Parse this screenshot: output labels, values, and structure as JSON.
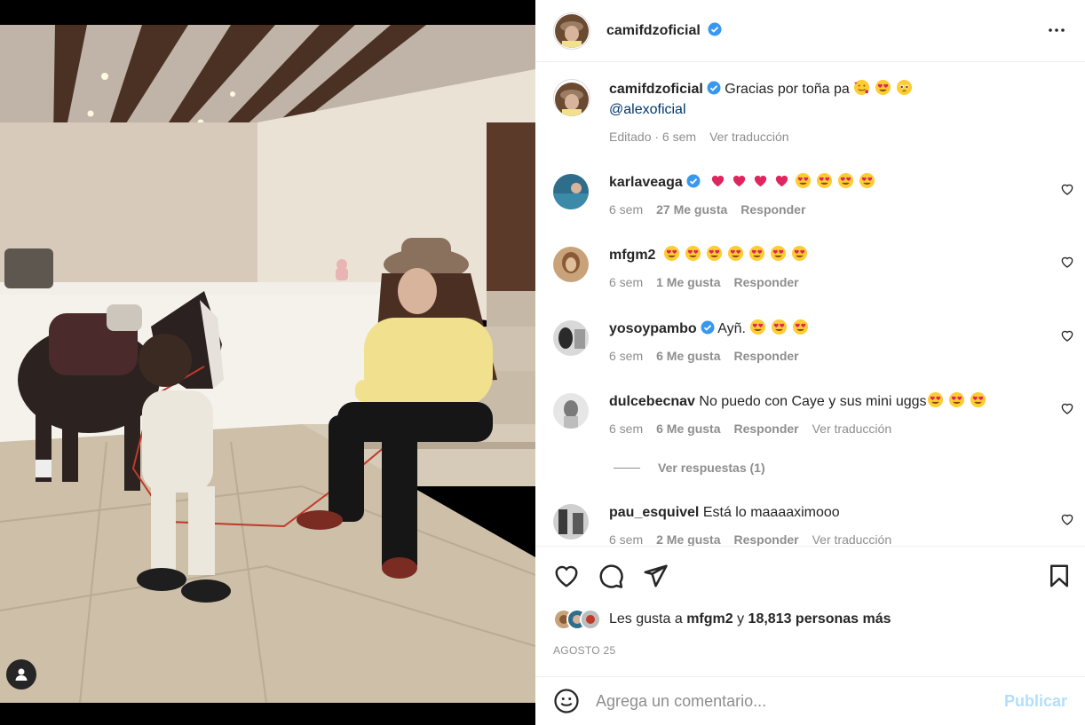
{
  "post": {
    "author": "camifdzoficial",
    "caption_text": "Gracias por toña pa",
    "caption_mention": "@alexoficial",
    "caption_meta_edited": "Editado · 6 sem",
    "caption_meta_translate": "Ver traducción"
  },
  "comments": [
    {
      "user": "karlaveaga",
      "verified": true,
      "text": "",
      "emojis": [
        "heart",
        "heart",
        "heart",
        "heart",
        "heart-eyes",
        "heart-eyes",
        "heart-eyes",
        "heart-eyes"
      ],
      "time": "6 sem",
      "likes": "27 Me gusta",
      "reply": "Responder",
      "translate": ""
    },
    {
      "user": "mfgm2",
      "verified": false,
      "text": "",
      "emojis": [
        "heart-eyes",
        "heart-eyes",
        "heart-eyes",
        "heart-eyes",
        "heart-eyes",
        "heart-eyes",
        "heart-eyes"
      ],
      "time": "6 sem",
      "likes": "1 Me gusta",
      "reply": "Responder",
      "translate": ""
    },
    {
      "user": "yosoypambo",
      "verified": true,
      "text": "Ayñ.",
      "emojis": [
        "heart-eyes",
        "heart-eyes",
        "heart-eyes"
      ],
      "time": "6 sem",
      "likes": "6 Me gusta",
      "reply": "Responder",
      "translate": ""
    },
    {
      "user": "dulcebecnav",
      "verified": false,
      "text": "No puedo con Caye y sus mini uggs",
      "emojis": [
        "heart-eyes",
        "heart-eyes",
        "heart-eyes"
      ],
      "time": "6 sem",
      "likes": "6 Me gusta",
      "reply": "Responder",
      "translate": "Ver traducción"
    },
    {
      "user": "pau_esquivel",
      "verified": false,
      "text": "Está lo maaaaximooo",
      "emojis": [],
      "time": "6 sem",
      "likes": "2 Me gusta",
      "reply": "Responder",
      "translate": "Ver traducción"
    }
  ],
  "view_replies": "Ver respuestas (1)",
  "likes": {
    "prefix": "Les gusta a",
    "user": "mfgm2",
    "connector": "y",
    "count": "18,813 personas más"
  },
  "date": "AGOSTO 25",
  "add_comment": {
    "placeholder": "Agrega un comentario...",
    "publish": "Publicar"
  },
  "colors": {
    "verified": "#3897f0",
    "link": "#00376b",
    "muted": "#8e8e8e",
    "publish_disabled": "#b2dffc"
  }
}
